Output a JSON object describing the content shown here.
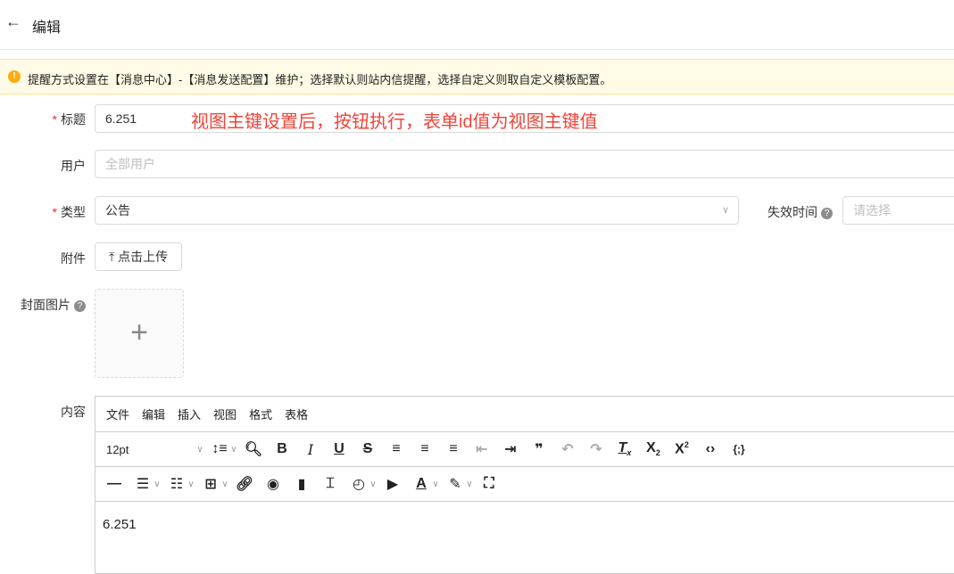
{
  "header": {
    "title": "编辑"
  },
  "alert": {
    "text": "提醒方式设置在【消息中心】-【消息发送配置】维护；选择默认则站内信提醒，选择自定义则取自定义模板配置。"
  },
  "annotation": "视图主键设置后，按钮执行，表单id值为视图主键值",
  "form": {
    "title_label": "标题",
    "title_value": "6.251",
    "user_label": "用户",
    "user_placeholder": "全部用户",
    "type_label": "类型",
    "type_value": "公告",
    "expire_label": "失效时间",
    "expire_placeholder": "请选择",
    "attach_label": "附件",
    "upload_label": "点击上传",
    "cover_label": "封面图片",
    "content_label": "内容"
  },
  "editor": {
    "menus": [
      "文件",
      "编辑",
      "插入",
      "视图",
      "格式",
      "表格"
    ],
    "font_size": "12pt",
    "content": "6.251"
  }
}
